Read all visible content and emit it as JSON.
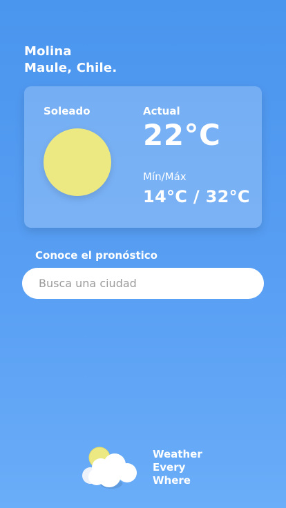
{
  "location": {
    "city": "Molina",
    "region": "Maule, Chile."
  },
  "weather": {
    "condition": "Soleado",
    "current_label": "Actual",
    "current_temp": "22°C",
    "minmax_label": "Mín/Máx",
    "minmax_value": "14°C / 32°C"
  },
  "forecast": {
    "label": "Conoce el pronóstico",
    "search_placeholder": "Busca una ciudad"
  },
  "brand": {
    "line1": "Weather",
    "line2": "Every",
    "line3": "Where",
    "icon": "sun-cloud-icon"
  },
  "colors": {
    "background": "#4a95ee",
    "sun": "#ece882",
    "card": "rgba(255,255,255,0.22)"
  }
}
